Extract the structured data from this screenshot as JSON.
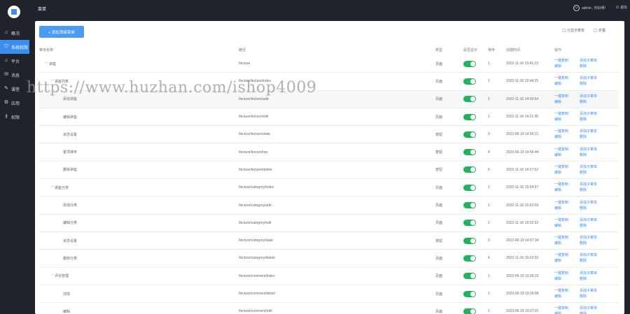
{
  "topbar": {
    "title": "菜单",
    "user": "admin , 你好呀!",
    "logout": "退出"
  },
  "sidebar": {
    "items": [
      {
        "label": "概况",
        "icon": "home-icon",
        "glyph": "⌂"
      },
      {
        "label": "系统权限",
        "icon": "shield-icon",
        "glyph": "⛉"
      },
      {
        "label": "平台",
        "icon": "platform-icon",
        "glyph": "⌂"
      },
      {
        "label": "消息",
        "icon": "mail-icon",
        "glyph": "✉"
      },
      {
        "label": "课堂",
        "icon": "class-icon",
        "glyph": "✎"
      },
      {
        "label": "应用",
        "icon": "app-icon",
        "glyph": "⚙"
      },
      {
        "label": "权限",
        "icon": "key-icon",
        "glyph": "⚷"
      }
    ],
    "active_index": 1
  },
  "toolbar": {
    "add_label": "+ 添加顶级菜单",
    "expand_label": "只显示菜单",
    "fold_label": "折叠"
  },
  "table": {
    "headers": {
      "name": "菜单名称",
      "path": "路径",
      "type": "类型",
      "show": "是否显示",
      "sort": "排序",
      "time": "创建时间",
      "ops": "操作"
    },
    "rows": [
      {
        "level": 0,
        "arrow": true,
        "name": "讲座",
        "path": "/lecture",
        "type": "页面",
        "sort": "1",
        "time": "2022-11-16 15:41:23",
        "ops": [
          "一键复制",
          "添加子菜单",
          "编辑",
          "删除"
        ]
      },
      {
        "level": 1,
        "arrow": true,
        "name": "讲座列表",
        "path": "/lecture/lecture/index",
        "type": "页面",
        "sort": "1",
        "time": "2022-11-16 15:44:25",
        "ops": [
          "一键复制",
          "添加子菜单",
          "编辑",
          "删除"
        ]
      },
      {
        "level": 2,
        "arrow": false,
        "name": "添加讲座",
        "path": "/lecture/lecture/add",
        "type": "页面",
        "sort": "1",
        "time": "2022-11-16 14:09:54",
        "ops": [
          "一键复制",
          "添加子菜单",
          "编辑",
          "删除"
        ]
      },
      {
        "level": 2,
        "arrow": false,
        "name": "编辑讲座",
        "path": "/lecture/lecture/edit",
        "type": "页面",
        "sort": "1",
        "time": "2022-11-16 14:21:36",
        "ops": [
          "一键复制",
          "添加子菜单",
          "编辑",
          "删除"
        ]
      },
      {
        "level": 2,
        "arrow": false,
        "name": "状态设置",
        "path": "/lecture/lecture/state",
        "type": "按钮",
        "sort": "3",
        "time": "2023-06-19 14:56:21",
        "ops": [
          "一键复制",
          "添加子菜单",
          "编辑",
          "删除"
        ]
      },
      {
        "level": 2,
        "arrow": false,
        "name": "置顶排序",
        "path": "/lecture/lecture/top",
        "type": "按钮",
        "sort": "4",
        "time": "2023-06-19 14:56:44",
        "ops": [
          "一键复制",
          "添加子菜单",
          "编辑",
          "删除"
        ]
      },
      {
        "level": 2,
        "arrow": false,
        "name": "删除讲座",
        "path": "/lecture/lecture/delete",
        "type": "按钮",
        "sort": "5",
        "time": "2022-11-16 14:27:52",
        "ops": [
          "一键复制",
          "添加子菜单",
          "编辑",
          "删除"
        ]
      },
      {
        "level": 1,
        "arrow": true,
        "name": "讲座分类",
        "path": "/lecture/category/index",
        "type": "页面",
        "sort": "1",
        "time": "2022-11-16 15:04:57",
        "ops": [
          "一键复制",
          "添加子菜单",
          "编辑",
          "删除"
        ]
      },
      {
        "level": 2,
        "arrow": false,
        "name": "添加分类",
        "path": "/lecture/category/add",
        "type": "页面",
        "sort": "1",
        "time": "2022-11-16 15:02:09",
        "ops": [
          "一键复制",
          "添加子菜单",
          "编辑",
          "删除"
        ]
      },
      {
        "level": 2,
        "arrow": false,
        "name": "编辑分类",
        "path": "/lecture/category/edit",
        "type": "页面",
        "sort": "2",
        "time": "2022-11-16 15:02:22",
        "ops": [
          "一键复制",
          "添加子菜单",
          "编辑",
          "删除"
        ]
      },
      {
        "level": 2,
        "arrow": false,
        "name": "状态设置",
        "path": "/lecture/category/state",
        "type": "按钮",
        "sort": "3",
        "time": "2023-06-19 14:57:34",
        "ops": [
          "一键复制",
          "添加子菜单",
          "编辑",
          "删除"
        ]
      },
      {
        "level": 2,
        "arrow": false,
        "name": "删除分类",
        "path": "/lecture/category/delete",
        "type": "页面",
        "sort": "4",
        "time": "2022-11-16 15:02:33",
        "ops": [
          "一键复制",
          "添加子菜单",
          "编辑",
          "删除"
        ]
      },
      {
        "level": 1,
        "arrow": true,
        "name": "评论管理",
        "path": "/lecture/comment/index",
        "type": "页面",
        "sort": "1",
        "time": "2023-06-19 10:36:23",
        "ops": [
          "一键复制",
          "添加子菜单",
          "编辑",
          "删除"
        ]
      },
      {
        "level": 2,
        "arrow": false,
        "name": "详情",
        "path": "/lecture/comment/detail",
        "type": "页面",
        "sort": "1",
        "time": "2023-06-19 10:36:58",
        "ops": [
          "一键复制",
          "添加子菜单",
          "编辑",
          "删除"
        ]
      },
      {
        "level": 2,
        "arrow": false,
        "name": "编辑",
        "path": "/lecture/comment/edit",
        "type": "页面",
        "sort": "1",
        "time": "2023-06-19 10:37:01",
        "ops": [
          "一键复制",
          "添加子菜单",
          "编辑",
          "删除"
        ]
      }
    ],
    "highlight_index": 2
  },
  "watermark": "https://www.huzhan.com/ishop4009",
  "colors": {
    "primary": "#3b8df0",
    "switch_on": "#21b35a",
    "chrome": "#20232b"
  }
}
